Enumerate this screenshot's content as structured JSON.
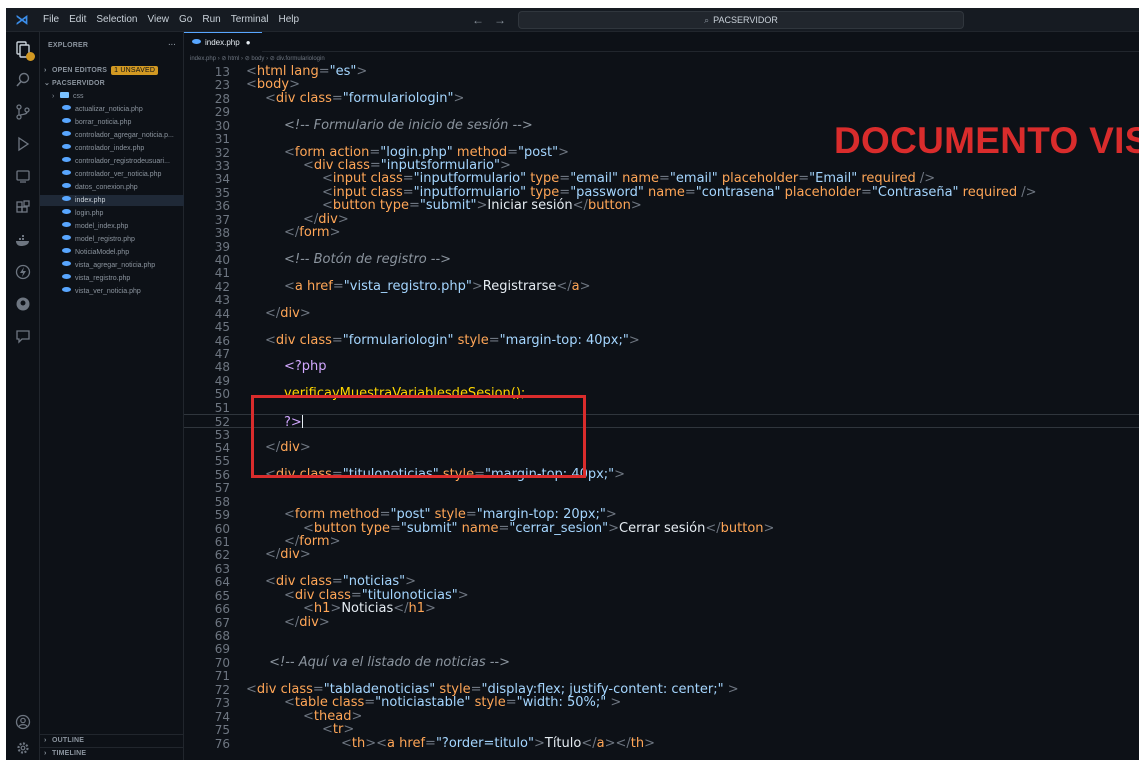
{
  "titlebar": {
    "logo": "⋊",
    "menu": [
      "File",
      "Edit",
      "Selection",
      "View",
      "Go",
      "Run",
      "Terminal",
      "Help"
    ],
    "back": "←",
    "forward": "→",
    "search_text": "PACSERVIDOR"
  },
  "sidebar": {
    "explorer_title": "EXPLORER",
    "explorer_more": "···",
    "open_editors": "OPEN EDITORS",
    "unsaved": "1 unsaved",
    "workspace": "PACSERVIDOR",
    "folder": "css",
    "files": [
      "actualizar_noticia.php",
      "borrar_noticia.php",
      "controlador_agregar_noticia.p...",
      "controlador_index.php",
      "controlador_registrodeusuari...",
      "controlador_ver_noticia.php",
      "datos_conexion.php",
      "index.php",
      "login.php",
      "model_index.php",
      "model_registro.php",
      "NoticiaModel.php",
      "vista_agregar_noticia.php",
      "vista_registro.php",
      "vista_ver_noticia.php"
    ],
    "selected_file": "index.php",
    "outline": "OUTLINE",
    "timeline": "TIMELINE"
  },
  "editor": {
    "tab_label": "index.php",
    "tab_dirty": "●",
    "breadcrumb": "index.php › ⊘ html › ⊘ body › ⊘ div.formulariologin"
  },
  "annotation": "DOCUMENTO VISTA",
  "colors": {
    "background": "#0d1117",
    "annotation": "#d92c2c",
    "tag": "#ffa657",
    "string": "#a5d6ff",
    "comment": "#8b949e"
  },
  "code_lines": [
    {
      "n": "13",
      "indent": 0,
      "tokens": [
        [
          "p",
          "<"
        ],
        [
          "t",
          "html"
        ],
        [
          "a",
          " lang"
        ],
        [
          "p",
          "="
        ],
        [
          "s",
          "\"es\""
        ],
        [
          "p",
          ">"
        ]
      ]
    },
    {
      "n": "23",
      "indent": 0,
      "tokens": [
        [
          "p",
          "<"
        ],
        [
          "t",
          "body"
        ],
        [
          "p",
          ">"
        ]
      ]
    },
    {
      "n": "28",
      "indent": 1,
      "tokens": [
        [
          "p",
          "<"
        ],
        [
          "t",
          "div"
        ],
        [
          "a",
          " class"
        ],
        [
          "p",
          "="
        ],
        [
          "s",
          "\"formulariologin\""
        ],
        [
          "p",
          ">"
        ]
      ]
    },
    {
      "n": "29",
      "indent": 0,
      "tokens": []
    },
    {
      "n": "30",
      "indent": 2,
      "tokens": [
        [
          "c",
          "<!-- Formulario de inicio de sesión -->"
        ]
      ]
    },
    {
      "n": "31",
      "indent": 0,
      "tokens": []
    },
    {
      "n": "32",
      "indent": 2,
      "tokens": [
        [
          "p",
          "<"
        ],
        [
          "t",
          "form"
        ],
        [
          "a",
          " action"
        ],
        [
          "p",
          "="
        ],
        [
          "s",
          "\"login.php\""
        ],
        [
          "a",
          " method"
        ],
        [
          "p",
          "="
        ],
        [
          "s",
          "\"post\""
        ],
        [
          "p",
          ">"
        ]
      ]
    },
    {
      "n": "33",
      "indent": 3,
      "tokens": [
        [
          "p",
          "<"
        ],
        [
          "t",
          "div"
        ],
        [
          "a",
          " class"
        ],
        [
          "p",
          "="
        ],
        [
          "s",
          "\"inputsformulario\""
        ],
        [
          "p",
          ">"
        ]
      ]
    },
    {
      "n": "34",
      "indent": 4,
      "tokens": [
        [
          "p",
          "<"
        ],
        [
          "t",
          "input"
        ],
        [
          "a",
          " class"
        ],
        [
          "p",
          "="
        ],
        [
          "s",
          "\"inputformulario\""
        ],
        [
          "a",
          " type"
        ],
        [
          "p",
          "="
        ],
        [
          "s",
          "\"email\""
        ],
        [
          "a",
          " name"
        ],
        [
          "p",
          "="
        ],
        [
          "s",
          "\"email\""
        ],
        [
          "a",
          " placeholder"
        ],
        [
          "p",
          "="
        ],
        [
          "s",
          "\"Email\""
        ],
        [
          "a",
          " required"
        ],
        [
          "p",
          " />"
        ]
      ]
    },
    {
      "n": "35",
      "indent": 4,
      "tokens": [
        [
          "p",
          "<"
        ],
        [
          "t",
          "input"
        ],
        [
          "a",
          " class"
        ],
        [
          "p",
          "="
        ],
        [
          "s",
          "\"inputformulario\""
        ],
        [
          "a",
          " type"
        ],
        [
          "p",
          "="
        ],
        [
          "s",
          "\"password\""
        ],
        [
          "a",
          " name"
        ],
        [
          "p",
          "="
        ],
        [
          "s",
          "\"contrasena\""
        ],
        [
          "a",
          " placeholder"
        ],
        [
          "p",
          "="
        ],
        [
          "s",
          "\"Contraseña\""
        ],
        [
          "a",
          " required"
        ],
        [
          "p",
          " />"
        ]
      ]
    },
    {
      "n": "36",
      "indent": 4,
      "tokens": [
        [
          "p",
          "<"
        ],
        [
          "t",
          "button"
        ],
        [
          "a",
          " type"
        ],
        [
          "p",
          "="
        ],
        [
          "s",
          "\"submit\""
        ],
        [
          "p",
          ">"
        ],
        [
          "x",
          "Iniciar sesión"
        ],
        [
          "p",
          "</"
        ],
        [
          "t",
          "button"
        ],
        [
          "p",
          ">"
        ]
      ]
    },
    {
      "n": "37",
      "indent": 3,
      "tokens": [
        [
          "p",
          "</"
        ],
        [
          "t",
          "div"
        ],
        [
          "p",
          ">"
        ]
      ]
    },
    {
      "n": "38",
      "indent": 2,
      "tokens": [
        [
          "p",
          "</"
        ],
        [
          "t",
          "form"
        ],
        [
          "p",
          ">"
        ]
      ]
    },
    {
      "n": "39",
      "indent": 0,
      "tokens": []
    },
    {
      "n": "40",
      "indent": 2,
      "tokens": [
        [
          "c",
          "<!-- Botón de registro -->"
        ]
      ]
    },
    {
      "n": "41",
      "indent": 0,
      "tokens": []
    },
    {
      "n": "42",
      "indent": 2,
      "tokens": [
        [
          "p",
          "<"
        ],
        [
          "t",
          "a"
        ],
        [
          "a",
          " href"
        ],
        [
          "p",
          "="
        ],
        [
          "s",
          "\"vista_registro.php\""
        ],
        [
          "p",
          ">"
        ],
        [
          "x",
          "Registrarse"
        ],
        [
          "p",
          "</"
        ],
        [
          "t",
          "a"
        ],
        [
          "p",
          ">"
        ]
      ]
    },
    {
      "n": "43",
      "indent": 0,
      "tokens": []
    },
    {
      "n": "44",
      "indent": 1,
      "tokens": [
        [
          "p",
          "</"
        ],
        [
          "t",
          "div"
        ],
        [
          "p",
          ">"
        ]
      ]
    },
    {
      "n": "45",
      "indent": 0,
      "tokens": []
    },
    {
      "n": "46",
      "indent": 1,
      "tokens": [
        [
          "p",
          "<"
        ],
        [
          "t",
          "div"
        ],
        [
          "a",
          " class"
        ],
        [
          "p",
          "="
        ],
        [
          "s",
          "\"formulariologin\""
        ],
        [
          "a",
          " style"
        ],
        [
          "p",
          "="
        ],
        [
          "s",
          "\"margin-top: 40px;\""
        ],
        [
          "p",
          ">"
        ]
      ]
    },
    {
      "n": "47",
      "indent": 0,
      "tokens": []
    },
    {
      "n": "48",
      "indent": 2,
      "tokens": [
        [
          "l",
          "<?php"
        ]
      ]
    },
    {
      "n": "49",
      "indent": 0,
      "tokens": []
    },
    {
      "n": "50",
      "indent": 2,
      "tokens": [
        [
          "f",
          "verificayMuestraVariablesdeSesion();"
        ]
      ]
    },
    {
      "n": "51",
      "indent": 0,
      "tokens": []
    },
    {
      "n": "52",
      "indent": 2,
      "tokens": [
        [
          "l",
          "?>"
        ],
        [
          "k",
          ""
        ]
      ],
      "active": true
    },
    {
      "n": "53",
      "indent": 0,
      "tokens": []
    },
    {
      "n": "54",
      "indent": 1,
      "tokens": [
        [
          "p",
          "</"
        ],
        [
          "t",
          "div"
        ],
        [
          "p",
          ">"
        ]
      ]
    },
    {
      "n": "55",
      "indent": 0,
      "tokens": []
    },
    {
      "n": "56",
      "indent": 1,
      "tokens": [
        [
          "p",
          "<"
        ],
        [
          "t",
          "div"
        ],
        [
          "a",
          " class"
        ],
        [
          "p",
          "="
        ],
        [
          "s",
          "\"titulonoticias\""
        ],
        [
          "a",
          " style"
        ],
        [
          "p",
          "="
        ],
        [
          "s",
          "\"margin-top: 40px;\""
        ],
        [
          "p",
          ">"
        ]
      ]
    },
    {
      "n": "57",
      "indent": 0,
      "tokens": []
    },
    {
      "n": "58",
      "indent": 0,
      "tokens": []
    },
    {
      "n": "59",
      "indent": 2,
      "tokens": [
        [
          "p",
          "<"
        ],
        [
          "t",
          "form"
        ],
        [
          "a",
          " method"
        ],
        [
          "p",
          "="
        ],
        [
          "s",
          "\"post\""
        ],
        [
          "a",
          " style"
        ],
        [
          "p",
          "="
        ],
        [
          "s",
          "\"margin-top: 20px;\""
        ],
        [
          "p",
          ">"
        ]
      ]
    },
    {
      "n": "60",
      "indent": 3,
      "tokens": [
        [
          "p",
          "<"
        ],
        [
          "t",
          "button"
        ],
        [
          "a",
          " type"
        ],
        [
          "p",
          "="
        ],
        [
          "s",
          "\"submit\""
        ],
        [
          "a",
          " name"
        ],
        [
          "p",
          "="
        ],
        [
          "s",
          "\"cerrar_sesion\""
        ],
        [
          "p",
          ">"
        ],
        [
          "x",
          "Cerrar sesión"
        ],
        [
          "p",
          "</"
        ],
        [
          "t",
          "button"
        ],
        [
          "p",
          ">"
        ]
      ]
    },
    {
      "n": "61",
      "indent": 2,
      "tokens": [
        [
          "p",
          "</"
        ],
        [
          "t",
          "form"
        ],
        [
          "p",
          ">"
        ]
      ]
    },
    {
      "n": "62",
      "indent": 1,
      "tokens": [
        [
          "p",
          "</"
        ],
        [
          "t",
          "div"
        ],
        [
          "p",
          ">"
        ]
      ]
    },
    {
      "n": "63",
      "indent": 0,
      "tokens": []
    },
    {
      "n": "64",
      "indent": 1,
      "tokens": [
        [
          "p",
          "<"
        ],
        [
          "t",
          "div"
        ],
        [
          "a",
          " class"
        ],
        [
          "p",
          "="
        ],
        [
          "s",
          "\"noticias\""
        ],
        [
          "p",
          ">"
        ]
      ]
    },
    {
      "n": "65",
      "indent": 2,
      "tokens": [
        [
          "p",
          "<"
        ],
        [
          "t",
          "div"
        ],
        [
          "a",
          " class"
        ],
        [
          "p",
          "="
        ],
        [
          "s",
          "\"titulonoticias\""
        ],
        [
          "p",
          ">"
        ]
      ]
    },
    {
      "n": "66",
      "indent": 3,
      "tokens": [
        [
          "p",
          "<"
        ],
        [
          "t",
          "h1"
        ],
        [
          "p",
          ">"
        ],
        [
          "x",
          "Noticias"
        ],
        [
          "p",
          "</"
        ],
        [
          "t",
          "h1"
        ],
        [
          "p",
          ">"
        ]
      ]
    },
    {
      "n": "67",
      "indent": 2,
      "tokens": [
        [
          "p",
          "</"
        ],
        [
          "t",
          "div"
        ],
        [
          "p",
          ">"
        ]
      ]
    },
    {
      "n": "68",
      "indent": 0,
      "tokens": []
    },
    {
      "n": "69",
      "indent": 0,
      "tokens": []
    },
    {
      "n": "70",
      "indent": 1,
      "tokens": [
        [
          "c",
          " <!-- Aquí va el listado de noticias -->"
        ]
      ]
    },
    {
      "n": "71",
      "indent": 0,
      "tokens": []
    },
    {
      "n": "72",
      "indent": 0,
      "tokens": [
        [
          "p",
          "<"
        ],
        [
          "t",
          "div"
        ],
        [
          "a",
          " class"
        ],
        [
          "p",
          "="
        ],
        [
          "s",
          "\"tabladenoticias\""
        ],
        [
          "a",
          " style"
        ],
        [
          "p",
          "="
        ],
        [
          "s",
          "\"display:flex; justify-content: center;\""
        ],
        [
          "p",
          " >"
        ]
      ]
    },
    {
      "n": "73",
      "indent": 2,
      "tokens": [
        [
          "p",
          "<"
        ],
        [
          "t",
          "table"
        ],
        [
          "a",
          " class"
        ],
        [
          "p",
          "="
        ],
        [
          "s",
          "\"noticiastable\""
        ],
        [
          "a",
          " style"
        ],
        [
          "p",
          "="
        ],
        [
          "s",
          "\"width: 50%;\""
        ],
        [
          "p",
          " >"
        ]
      ]
    },
    {
      "n": "74",
      "indent": 3,
      "tokens": [
        [
          "p",
          "<"
        ],
        [
          "t",
          "thead"
        ],
        [
          "p",
          ">"
        ]
      ]
    },
    {
      "n": "75",
      "indent": 4,
      "tokens": [
        [
          "p",
          "<"
        ],
        [
          "t",
          "tr"
        ],
        [
          "p",
          ">"
        ]
      ]
    },
    {
      "n": "76",
      "indent": 5,
      "tokens": [
        [
          "p",
          "<"
        ],
        [
          "t",
          "th"
        ],
        [
          "p",
          "><"
        ],
        [
          "t",
          "a"
        ],
        [
          "a",
          " href"
        ],
        [
          "p",
          "="
        ],
        [
          "s",
          "\"?order=titulo\""
        ],
        [
          "p",
          ">"
        ],
        [
          "x",
          "Título"
        ],
        [
          "p",
          "</"
        ],
        [
          "t",
          "a"
        ],
        [
          "p",
          "></"
        ],
        [
          "t",
          "th"
        ],
        [
          "p",
          ">"
        ]
      ]
    }
  ]
}
